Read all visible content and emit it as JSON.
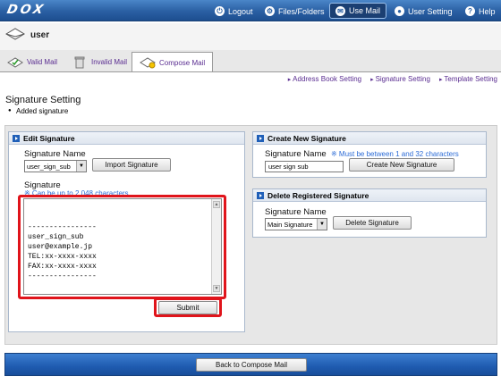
{
  "app": {
    "logo": "DOX",
    "user": "user"
  },
  "nav": [
    {
      "label": "Logout",
      "icon": "logout-icon"
    },
    {
      "label": "Files/Folders",
      "icon": "folders-icon"
    },
    {
      "label": "Use Mail",
      "icon": "mail-icon",
      "active": true
    },
    {
      "label": "User Setting",
      "icon": "user-setting-icon"
    },
    {
      "label": "Help",
      "icon": "help-icon"
    }
  ],
  "tabs": [
    {
      "label": "Valid Mail",
      "icon": "valid-mail-icon"
    },
    {
      "label": "Invalid Mail",
      "icon": "trash-icon"
    },
    {
      "label": "Compose Mail",
      "icon": "compose-mail-icon",
      "active": true
    }
  ],
  "settings_links": [
    "Address Book Setting",
    "Signature Setting",
    "Template Setting"
  ],
  "page": {
    "title": "Signature Setting",
    "message": "Added signature"
  },
  "edit_signature": {
    "header": "Edit Signature",
    "name_label": "Signature Name",
    "name_selected": "user_sign_sub",
    "import_button": "Import Signature",
    "signature_label": "Signature",
    "signature_note": "※ Can be up to 2,048 characters",
    "signature_text": "----------------\nuser_sign_sub\nuser@example.jp\nTEL:xx-xxxx-xxxx\nFAX:xx-xxxx-xxxx\n----------------",
    "submit_button": "Submit"
  },
  "create_signature": {
    "header": "Create New Signature",
    "name_label": "Signature Name",
    "name_note": "※ Must be between 1 and 32 characters",
    "name_value": "user sign sub",
    "create_button": "Create New Signature"
  },
  "delete_signature": {
    "header": "Delete Registered Signature",
    "name_label": "Signature Name",
    "name_selected": "Main Signature",
    "delete_button": "Delete Signature"
  },
  "footer": {
    "back_button": "Back to Compose Mail"
  },
  "colors": {
    "topbar": "#2a5fa3",
    "highlight": "#e0141b",
    "link": "#5a2d91",
    "note": "#2b6bd6"
  }
}
